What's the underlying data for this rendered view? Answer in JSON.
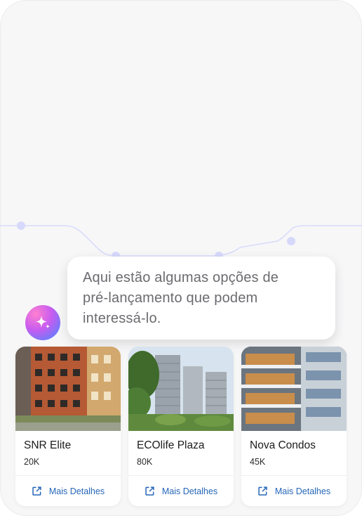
{
  "message": {
    "text_line1": "Aqui estão algumas opções de",
    "text_line2": "pré-lançamento que podem",
    "text_line3": "interessá-lo."
  },
  "assistant": {
    "icon": "sparkle-icon",
    "gradient": [
      "#ff7fd0",
      "#c65cf0",
      "#3f8bff"
    ]
  },
  "cards": [
    {
      "name": "SNR Elite",
      "price": "20K",
      "details_label": "Mais Detalhes",
      "image": "brick-apartment-building"
    },
    {
      "name": "ECOlife Plaza",
      "price": "80K",
      "details_label": "Mais Detalhes",
      "image": "green-towers"
    },
    {
      "name": "Nova Condos",
      "price": "45K",
      "details_label": "Mais Detalhes",
      "image": "modern-balcony-building"
    }
  ],
  "colors": {
    "link": "#2566b7",
    "background": "#f7f7f8",
    "decor": "#d9dcfb"
  }
}
